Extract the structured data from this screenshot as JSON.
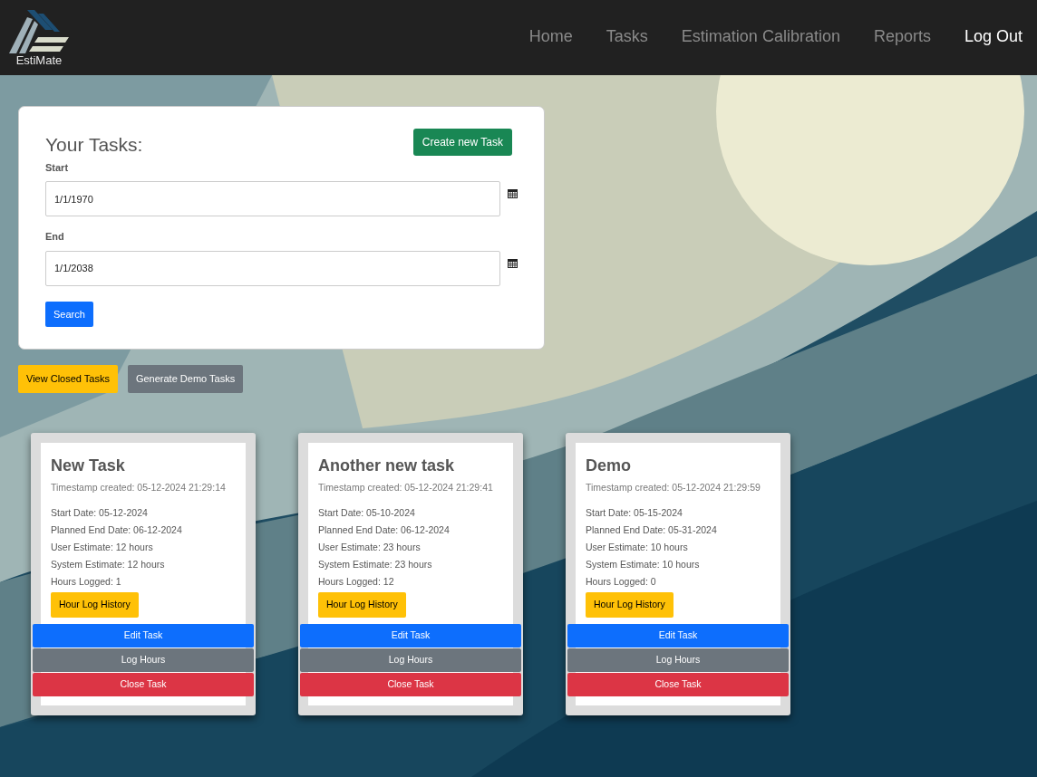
{
  "brand": {
    "name": "EstiMate"
  },
  "nav": [
    {
      "label": "Home",
      "kind": "link"
    },
    {
      "label": "Tasks",
      "kind": "link"
    },
    {
      "label": "Estimation Calibration",
      "kind": "link"
    },
    {
      "label": "Reports",
      "kind": "link"
    },
    {
      "label": "Log Out",
      "kind": "action"
    }
  ],
  "filter": {
    "title": "Your Tasks:",
    "create_button": "Create new Task",
    "fields": [
      {
        "label": "Start",
        "value": "1/1/1970"
      },
      {
        "label": "End",
        "value": "1/1/2038"
      }
    ],
    "search_button": "Search"
  },
  "actions": [
    {
      "label": "View Closed Tasks",
      "kind": "warning"
    },
    {
      "label": "Generate Demo Tasks",
      "kind": "secondary"
    }
  ],
  "tasks": [
    {
      "title": "New Task",
      "timestamp": "Timestamp created: 05-12-2024 21:29:14",
      "details": [
        "Start Date: 05-12-2024",
        "Planned End Date: 06-12-2024",
        "User Estimate: 12 hours",
        "System Estimate: 12 hours",
        "Hours Logged: 1"
      ],
      "history_button": "Hour Log History",
      "buttons": [
        {
          "label": "Edit Task",
          "kind": "primary"
        },
        {
          "label": "Log Hours",
          "kind": "secondary"
        },
        {
          "label": "Close Task",
          "kind": "danger"
        }
      ]
    },
    {
      "title": "Another new task",
      "timestamp": "Timestamp created: 05-12-2024 21:29:41",
      "details": [
        "Start Date: 05-10-2024",
        "Planned End Date: 06-12-2024",
        "User Estimate: 23 hours",
        "System Estimate: 23 hours",
        "Hours Logged: 12"
      ],
      "history_button": "Hour Log History",
      "buttons": [
        {
          "label": "Edit Task",
          "kind": "primary"
        },
        {
          "label": "Log Hours",
          "kind": "secondary"
        },
        {
          "label": "Close Task",
          "kind": "danger"
        }
      ]
    },
    {
      "title": "Demo",
      "timestamp": "Timestamp created: 05-12-2024 21:29:59",
      "details": [
        "Start Date: 05-15-2024",
        "Planned End Date: 05-31-2024",
        "User Estimate: 10 hours",
        "System Estimate: 10 hours",
        "Hours Logged: 0"
      ],
      "history_button": "Hour Log History",
      "buttons": [
        {
          "label": "Edit Task",
          "kind": "primary"
        },
        {
          "label": "Log Hours",
          "kind": "secondary"
        },
        {
          "label": "Close Task",
          "kind": "danger"
        }
      ]
    }
  ]
}
